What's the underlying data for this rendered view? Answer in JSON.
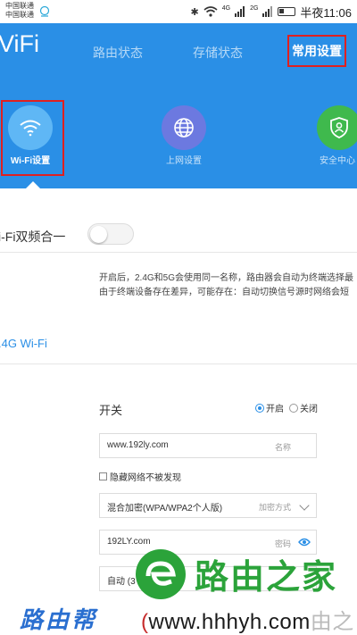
{
  "status_bar": {
    "carrier_1": "中国联通",
    "carrier_2": "中国联通",
    "network_1": "4G",
    "network_2": "2G",
    "time": "半夜11:06"
  },
  "header": {
    "brand": "ViFi",
    "tabs": [
      {
        "label": "路由状态",
        "active": false
      },
      {
        "label": "存储状态",
        "active": false
      },
      {
        "label": "常用设置",
        "active": true
      }
    ],
    "icons": [
      {
        "label": "Wi-Fi设置",
        "icon": "wifi-icon",
        "active": true
      },
      {
        "label": "上网设置",
        "icon": "globe-icon",
        "active": false
      },
      {
        "label": "安全中心",
        "icon": "shield-icon",
        "active": false
      }
    ],
    "colors": {
      "header_bg": "#2a8fe6",
      "highlight_border": "#e02020"
    }
  },
  "dual_band": {
    "label": "i-Fi双频合一",
    "enabled": false
  },
  "description": {
    "line1": "开启后，2.4G和5G会使用同一名称，路由器会自动为终端选择最",
    "line2": "由于终端设备存在差异，可能存在：自动切换信号源时网络会短"
  },
  "section": {
    "title": ".4G Wi-Fi"
  },
  "wifi_24g": {
    "switch_label": "开关",
    "on_label": "开启",
    "off_label": "关闭",
    "switch_state": "on",
    "ssid_value": "www.192ly.com",
    "ssid_tag": "名称",
    "hide_label": "隐藏网络不被发现",
    "hidden": false,
    "encryption_value": "混合加密(WPA/WPA2个人版)",
    "encryption_tag": "加密方式",
    "password_value": "192LY.com",
    "password_tag": "密码",
    "auto_value": "自动 (3"
  },
  "watermark": {
    "site_name_cn": "路由之家",
    "left_text": "路由帮",
    "url_open": "(",
    "url": "www.hhhyh.com",
    "url_suffix": "由之网",
    "brand_color": "#2ba33a"
  }
}
